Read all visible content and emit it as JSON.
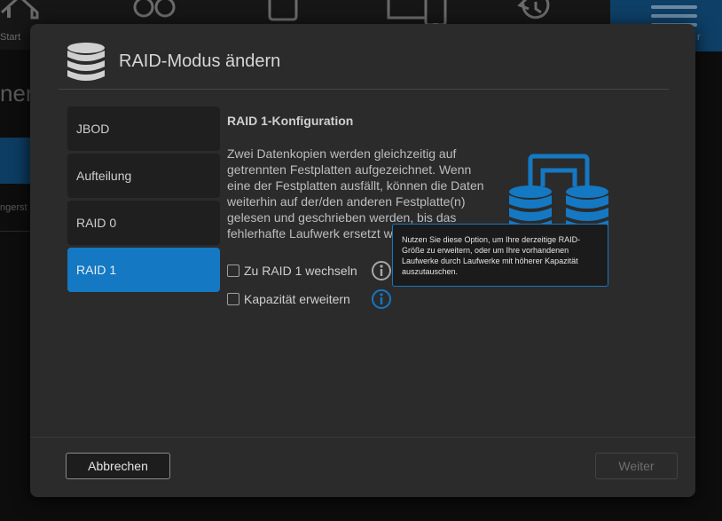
{
  "background": {
    "start_label": "Start",
    "menu_label": "r",
    "left_title": "ner",
    "left_text": "ngerst"
  },
  "modal": {
    "title": "RAID-Modus ändern",
    "title_icon": "database-icon"
  },
  "sidebar": {
    "items": [
      {
        "label": "JBOD"
      },
      {
        "label": "Aufteilung"
      },
      {
        "label": "RAID 0"
      },
      {
        "label": "RAID 1",
        "active": true
      }
    ]
  },
  "content": {
    "title": "RAID 1-Konfiguration",
    "description": "Zwei Datenkopien werden gleichzeitig auf getrennten Festplatten aufgezeichnet. Wenn eine der Festplatten ausfällt, können die Daten weiterhin auf der/den anderen Festplatte(n) gelesen und geschrieben werden, bis das fehlerhafte Laufwerk ersetzt wurde.",
    "options": [
      {
        "label": "Zu RAID 1 wechseln",
        "checked": false,
        "icon": "info-icon"
      },
      {
        "label": "Kapazität erweitern",
        "checked": false,
        "icon": "info-icon"
      }
    ],
    "tooltip": "Nutzen Sie diese Option, um Ihre derzeitige RAID-Größe zu erweitern, oder um Ihre vorhandenen Laufwerke durch Laufwerke mit höherer Kapazität auszutauschen.",
    "illustration_icon": "raid-mirror-icon"
  },
  "footer": {
    "cancel_label": "Abbrechen",
    "next_label": "Weiter"
  },
  "colors": {
    "accent": "#1578c2",
    "modal_bg": "#2b2b2b"
  }
}
